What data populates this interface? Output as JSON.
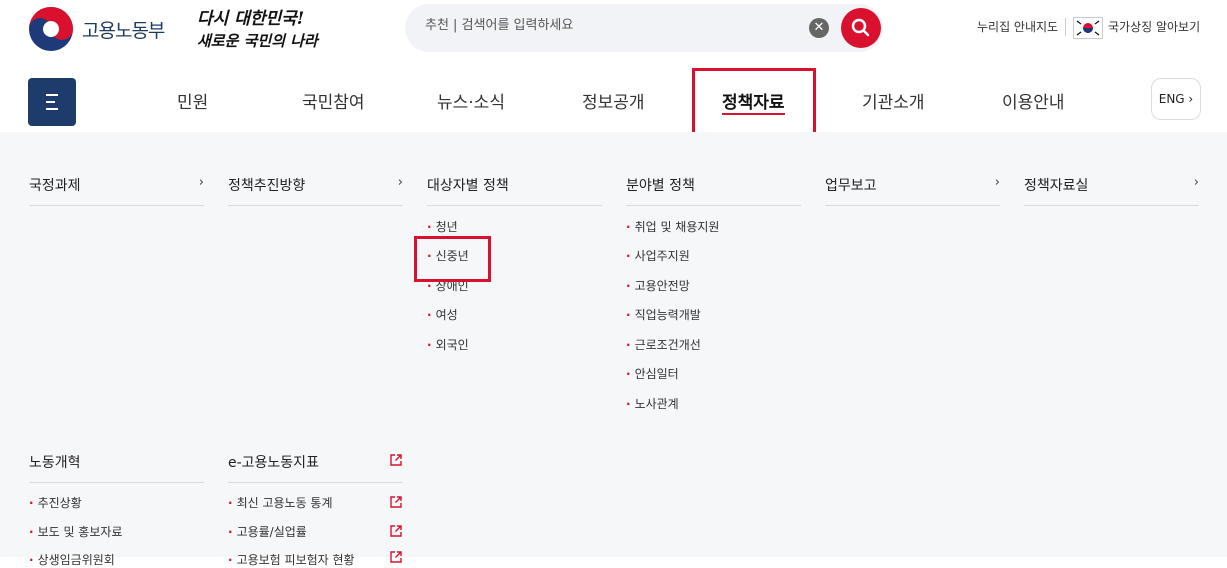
{
  "header": {
    "logo_text": "고용노동부",
    "slogan_line1": "다시 대한민국!",
    "slogan_line2": "새로운 국민의 나라",
    "search": {
      "placeholder": "추천 | 검색어를 입력하세요"
    },
    "util_links": [
      "누리집 안내지도",
      "국가상징 알아보기"
    ]
  },
  "gnb": {
    "items": [
      "민원",
      "국민참여",
      "뉴스·소식",
      "정보공개",
      "정책자료",
      "기관소개",
      "이용안내"
    ],
    "active": "정책자료",
    "lang_label": "ENG"
  },
  "mega_menu": {
    "columns": [
      {
        "title": "국정과제",
        "arrow": "›",
        "items": []
      },
      {
        "title": "정책추진방향",
        "arrow": "›",
        "items": []
      },
      {
        "title": "대상자별 정책",
        "items": [
          "청년",
          "신중년",
          "장애인",
          "여성",
          "외국인"
        ]
      },
      {
        "title": "분야별 정책",
        "items": [
          "취업 및 채용지원",
          "사업주지원",
          "고용안전망",
          "직업능력개발",
          "근로조건개선",
          "안심일터",
          "노사관계"
        ]
      },
      {
        "title": "업무보고",
        "arrow": "›",
        "items": []
      },
      {
        "title": "정책자료실",
        "arrow": "›",
        "items": []
      },
      {
        "title": "노동개혁",
        "items": [
          "추진상황",
          "보도 및 홍보자료",
          "상생임금위원회"
        ]
      },
      {
        "title": "e-고용노동지표",
        "items": [
          "최신 고용노동 통계",
          "고용률/실업률",
          "고용보험 피보험자 현황"
        ]
      }
    ]
  },
  "colors": {
    "accent": "#d9112e",
    "navy": "#1d3c6b",
    "panel_bg": "#f6f7f9"
  }
}
